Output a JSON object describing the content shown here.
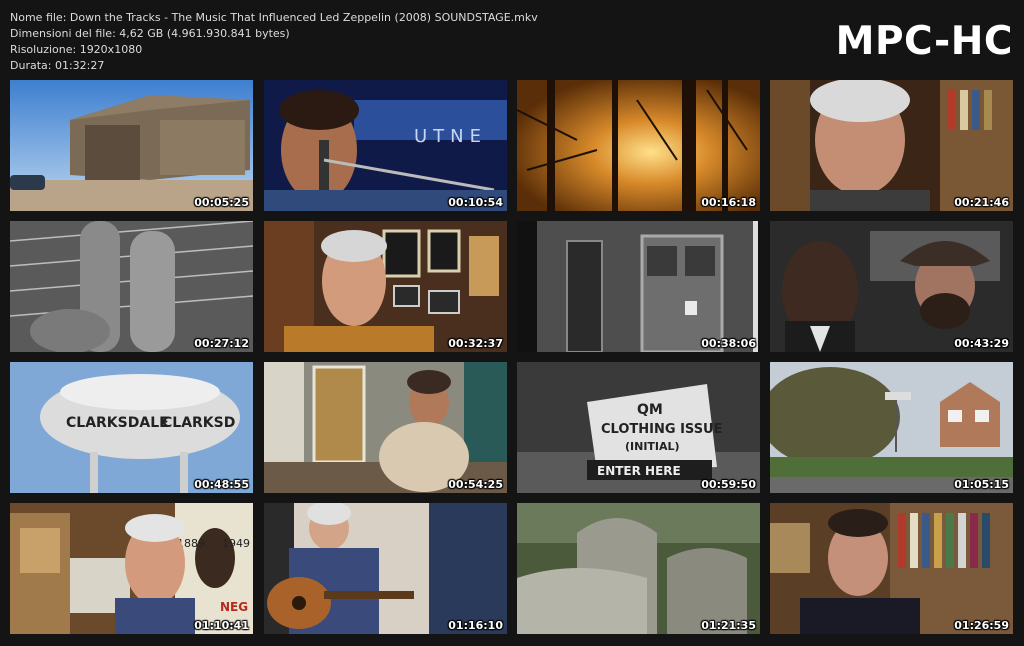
{
  "info": {
    "file_name": "Nome file: Down the Tracks - The Music That Influenced Led Zeppelin (2008) SOUNDSTAGE.mkv",
    "file_size": "Dimensioni del file: 4,62 GB (4.961.930.841 bytes)",
    "resolution": "Risoluzione: 1920x1080",
    "duration": "Durata: 01:32:27"
  },
  "logo": "MPC-HC",
  "overlay_texts": {
    "water_tower_left": "CLARKSDALE",
    "water_tower_right": "CLARKSD",
    "sign_line1": "QM",
    "sign_line2": "CLOTHING ISSUE",
    "sign_line3": "(INITIAL)",
    "sign_line4": "ENTER HERE",
    "poster_year1": "1889",
    "poster_year2": "1949",
    "poster_fragment": "NEG",
    "banner_text": "UTNE"
  },
  "thumbnails": [
    {
      "time": "00:05:25",
      "scene": "shack"
    },
    {
      "time": "00:10:54",
      "scene": "singer"
    },
    {
      "time": "00:16:18",
      "scene": "sunset-trees"
    },
    {
      "time": "00:21:46",
      "scene": "old-man-books"
    },
    {
      "time": "00:27:12",
      "scene": "guitar-strings"
    },
    {
      "time": "00:32:37",
      "scene": "man-orange-shirt"
    },
    {
      "time": "00:38:06",
      "scene": "brick-door"
    },
    {
      "time": "00:43:29",
      "scene": "two-men-car"
    },
    {
      "time": "00:48:55",
      "scene": "water-tower"
    },
    {
      "time": "00:54:25",
      "scene": "man-porch"
    },
    {
      "time": "00:59:50",
      "scene": "clothing-sign"
    },
    {
      "time": "01:05:15",
      "scene": "village-road"
    },
    {
      "time": "01:10:41",
      "scene": "man-poster"
    },
    {
      "time": "01:16:10",
      "scene": "man-guitar"
    },
    {
      "time": "01:21:35",
      "scene": "gravestones"
    },
    {
      "time": "01:26:59",
      "scene": "man-glasses-books"
    }
  ],
  "colors": {
    "background": "#141414",
    "text": "#dcdcdc",
    "logo": "#ffffff"
  }
}
